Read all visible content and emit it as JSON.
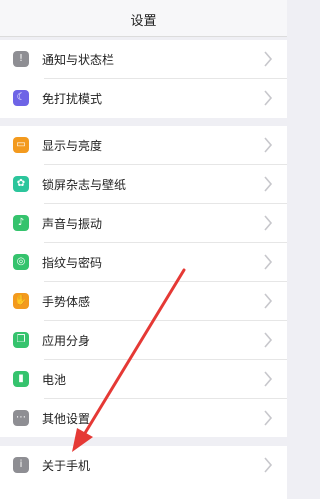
{
  "header": {
    "title": "设置"
  },
  "groups": [
    {
      "items": [
        {
          "label": "通知与状态栏",
          "icon": "notification-icon",
          "color": "#8e8e93"
        },
        {
          "label": "免打扰模式",
          "icon": "moon-icon",
          "color": "#6e64e6"
        }
      ]
    },
    {
      "items": [
        {
          "label": "显示与亮度",
          "icon": "display-icon",
          "color": "#f39a1e"
        },
        {
          "label": "锁屏杂志与壁纸",
          "icon": "flower-icon",
          "color": "#2cc59c"
        },
        {
          "label": "声音与振动",
          "icon": "speaker-icon",
          "color": "#35c36d"
        },
        {
          "label": "指纹与密码",
          "icon": "fingerprint-icon",
          "color": "#35c36d"
        },
        {
          "label": "手势体感",
          "icon": "hand-icon",
          "color": "#f39a1e"
        },
        {
          "label": "应用分身",
          "icon": "clone-icon",
          "color": "#35c36d"
        },
        {
          "label": "电池",
          "icon": "battery-icon",
          "color": "#35c36d"
        },
        {
          "label": "其他设置",
          "icon": "more-icon",
          "color": "#8e8e93"
        }
      ]
    },
    {
      "items": [
        {
          "label": "关于手机",
          "icon": "info-icon",
          "color": "#8e8e93"
        }
      ]
    }
  ]
}
